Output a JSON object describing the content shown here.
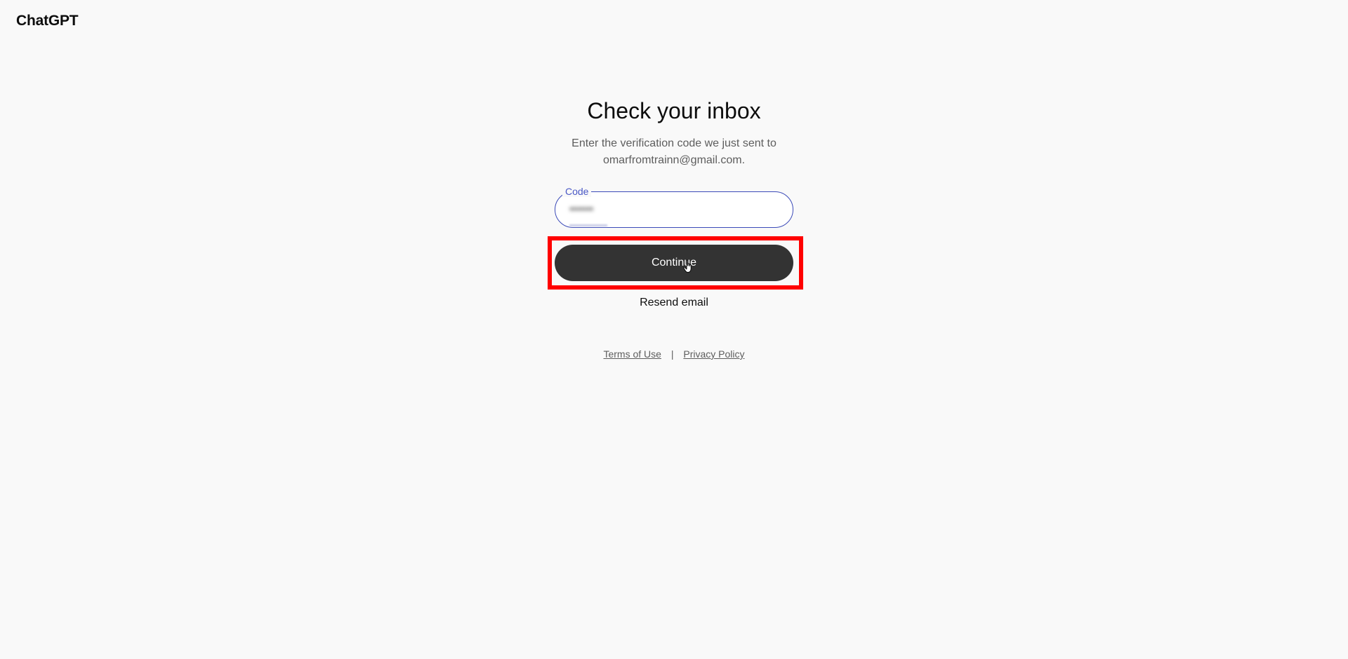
{
  "brand": {
    "name": "ChatGPT"
  },
  "main": {
    "title": "Check your inbox",
    "subtitle_line1": "Enter the verification code we just sent to",
    "subtitle_line2": "omarfromtrainn@gmail.com.",
    "code_field": {
      "label": "Code",
      "value": "▪▪▪▪▪▪"
    },
    "continue_label": "Continue",
    "resend_label": "Resend email"
  },
  "footer": {
    "terms_label": "Terms of Use",
    "separator": "|",
    "privacy_label": "Privacy Policy"
  },
  "colors": {
    "background": "#f9f9f9",
    "button": "#333333",
    "field_border": "#3b4ab8",
    "highlight": "#ff0000"
  },
  "icons": {
    "cursor": "hand-pointer-icon"
  }
}
